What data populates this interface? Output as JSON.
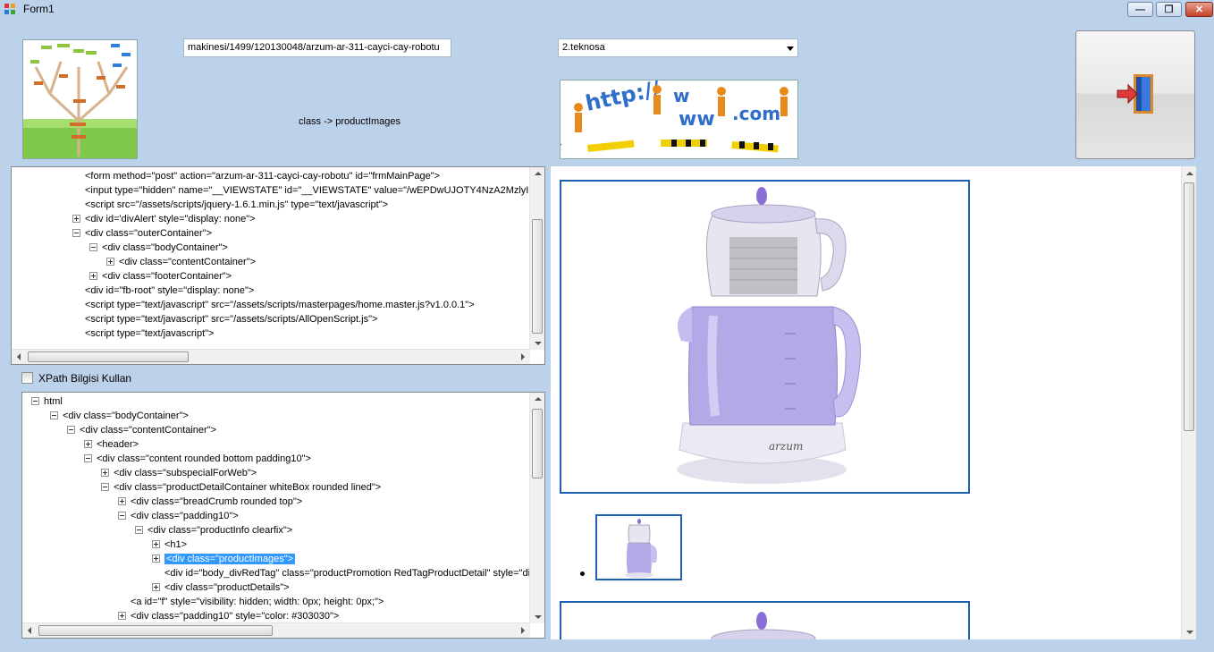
{
  "window": {
    "title": "Form1",
    "min_label": "▭",
    "max_label": "▣",
    "close_label": "✕"
  },
  "top": {
    "url_value": "makinesi/1499/120130048/arzum-ar-311-cayci-cay-robotu",
    "class_label": "class -> productImages",
    "site_select_value": "2.teknosa",
    "banner_text": "http://www.com"
  },
  "source_tree": {
    "lines": [
      "<form method=\"post\" action=\"arzum-ar-311-cayci-cay-robotu\" id=\"frmMainPage\">",
      "<input type=\"hidden\" name=\"__VIEWSTATE\" id=\"__VIEWSTATE\" value=\"/wEPDwUJOTY4NzA2MzlyI",
      "<script src=\"/assets/scripts/jquery-1.6.1.min.js\" type=\"text/javascript\">",
      "<div id='divAlert' style=\"display: none\">",
      "<div class=\"outerContainer\">",
      "<div class=\"bodyContainer\">",
      "<div class=\"contentContainer\">",
      "<div class=\"footerContainer\">",
      "<div id=\"fb-root\" style=\"display: none\">",
      "<script type=\"text/javascript\" src=\"/assets/scripts/masterpages/home.master.js?v1.0.0.1\">",
      "<script type=\"text/javascript\" src=\"/assets/scripts/AllOpenScript.js\">",
      "<script type=\"text/javascript\">"
    ]
  },
  "xpath_checkbox": {
    "label": "XPath Bilgisi Kullan",
    "checked": false
  },
  "result_tree": {
    "lines": [
      "html",
      "<div class=\"bodyContainer\">",
      "<div class=\"contentContainer\">",
      "<header>",
      "<div class=\"content rounded bottom padding10\">",
      "<div class=\"subspecialForWeb\">",
      "<div class=\"productDetailContainer whiteBox rounded lined\">",
      "<div class=\"breadCrumb rounded top\">",
      "<div class=\"padding10\">",
      "<div class=\"productInfo clearfix\">",
      "<h1>",
      "<div class=\"productImages\">",
      "<div id=\"body_divRedTag\" class=\"productPromotion RedTagProductDetail\" style=\"dis",
      "<div class=\"productDetails\">",
      "<a id=\"f\" style=\"visibility: hidden; width: 0px; height: 0px;\">",
      "<div class=\"padding10\" style=\"color: #303030\">"
    ]
  },
  "product_image": {
    "brand": "arzum"
  }
}
